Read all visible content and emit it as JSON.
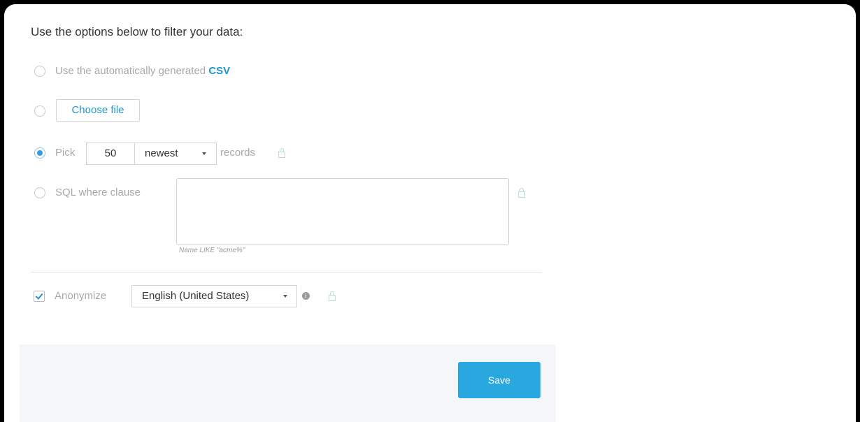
{
  "heading": "Use the options below to filter your data:",
  "options": {
    "auto_csv": {
      "label_prefix": "Use the automatically generated",
      "label_link": "CSV"
    },
    "choose_file": {
      "button_label": "Choose file"
    },
    "pick": {
      "label": "Pick",
      "count": "50",
      "order": "newest",
      "suffix": "records"
    },
    "sql": {
      "label": "SQL where clause",
      "value": "",
      "hint": "Name LIKE \"acme%\""
    }
  },
  "anonymize": {
    "label": "Anonymize",
    "locale": "English (United States)",
    "checked": true
  },
  "footer": {
    "save_label": "Save"
  },
  "colors": {
    "accent": "#29a8e0",
    "link": "#1f95c9",
    "muted_text": "#a8a8a8"
  },
  "icons": {
    "lock": "lock-icon",
    "info": "info-icon",
    "caret": "caret-down-icon"
  }
}
